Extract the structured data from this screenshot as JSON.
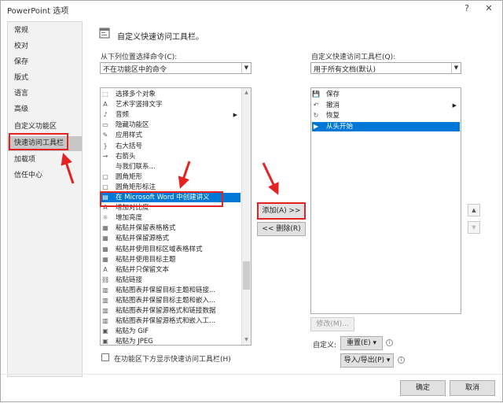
{
  "window": {
    "title": "PowerPoint 选项",
    "help_glyph": "?",
    "close_glyph": "✕"
  },
  "sidebar": {
    "items": [
      {
        "label": "常规"
      },
      {
        "label": "校对"
      },
      {
        "label": "保存"
      },
      {
        "label": "版式"
      },
      {
        "label": "语言"
      },
      {
        "label": "高级"
      },
      {
        "label": "自定义功能区"
      },
      {
        "label": "快速访问工具栏",
        "active": true
      },
      {
        "label": "加载项"
      },
      {
        "label": "信任中心"
      }
    ]
  },
  "main": {
    "title": "自定义快速访问工具栏。",
    "choose_from_label": "从下列位置选择命令(C):",
    "choose_from_value": "不在功能区中的命令",
    "customize_label": "自定义快速访问工具栏(Q):",
    "customize_value": "用于所有文档(默认)",
    "commands": [
      {
        "icon": "⬚",
        "label": "选择多个对象"
      },
      {
        "icon": "A",
        "label": "艺术字竖排文字"
      },
      {
        "icon": "♪",
        "label": "音频",
        "has_arrow": true
      },
      {
        "icon": "▭",
        "label": "隐藏功能区"
      },
      {
        "icon": "✎",
        "label": "应用样式"
      },
      {
        "icon": "}",
        "label": "右大括号"
      },
      {
        "icon": "→",
        "label": "右箭头"
      },
      {
        "icon": "",
        "label": "与我们联系..."
      },
      {
        "icon": "▢",
        "label": "圆角矩形"
      },
      {
        "icon": "▢",
        "label": "圆角矩形标注"
      },
      {
        "icon": "▤",
        "label": "在 Microsoft Word 中创建讲义",
        "selected": true
      },
      {
        "icon": "A",
        "label": "增加对比度"
      },
      {
        "icon": "☼",
        "label": "增加亮度"
      },
      {
        "icon": "▦",
        "label": "粘贴并保留表格格式"
      },
      {
        "icon": "▦",
        "label": "粘贴并保留源格式"
      },
      {
        "icon": "▦",
        "label": "粘贴并使用目标区域表格样式"
      },
      {
        "icon": "▦",
        "label": "粘贴并使用目标主题"
      },
      {
        "icon": "A",
        "label": "粘贴并只保留文本"
      },
      {
        "icon": "⛓",
        "label": "粘贴链接"
      },
      {
        "icon": "▥",
        "label": "粘贴图表并保留目标主题和链接..."
      },
      {
        "icon": "▥",
        "label": "粘贴图表并保留目标主题和嵌入..."
      },
      {
        "icon": "▥",
        "label": "粘贴图表并保留源格式和链接数据"
      },
      {
        "icon": "▥",
        "label": "粘贴图表并保留源格式和嵌入工..."
      },
      {
        "icon": "▣",
        "label": "粘贴为 GIF"
      },
      {
        "icon": "▣",
        "label": "粘贴为 JPEG"
      }
    ],
    "toolbar_items": [
      {
        "icon": "💾",
        "label": "保存"
      },
      {
        "icon": "↶",
        "label": "撤消",
        "has_arrow": true
      },
      {
        "icon": "↻",
        "label": "恢复"
      },
      {
        "icon": "▶",
        "label": "从头开始",
        "selected": true
      }
    ],
    "add_button": "添加(A) >>",
    "remove_button": "<< 删除(R)",
    "modify_button": "修改(M)...",
    "customize_row_label": "自定义:",
    "reset_button": "重置(E) ▾",
    "import_export_button": "导入/导出(P) ▾",
    "show_below_ribbon": "在功能区下方显示快速访问工具栏(H)",
    "up_glyph": "▲",
    "down_glyph": "▼",
    "info_glyph": "i"
  },
  "footer": {
    "ok": "确定",
    "cancel": "取消"
  },
  "colors": {
    "accent": "#0078d7",
    "annotation": "#e42222"
  }
}
